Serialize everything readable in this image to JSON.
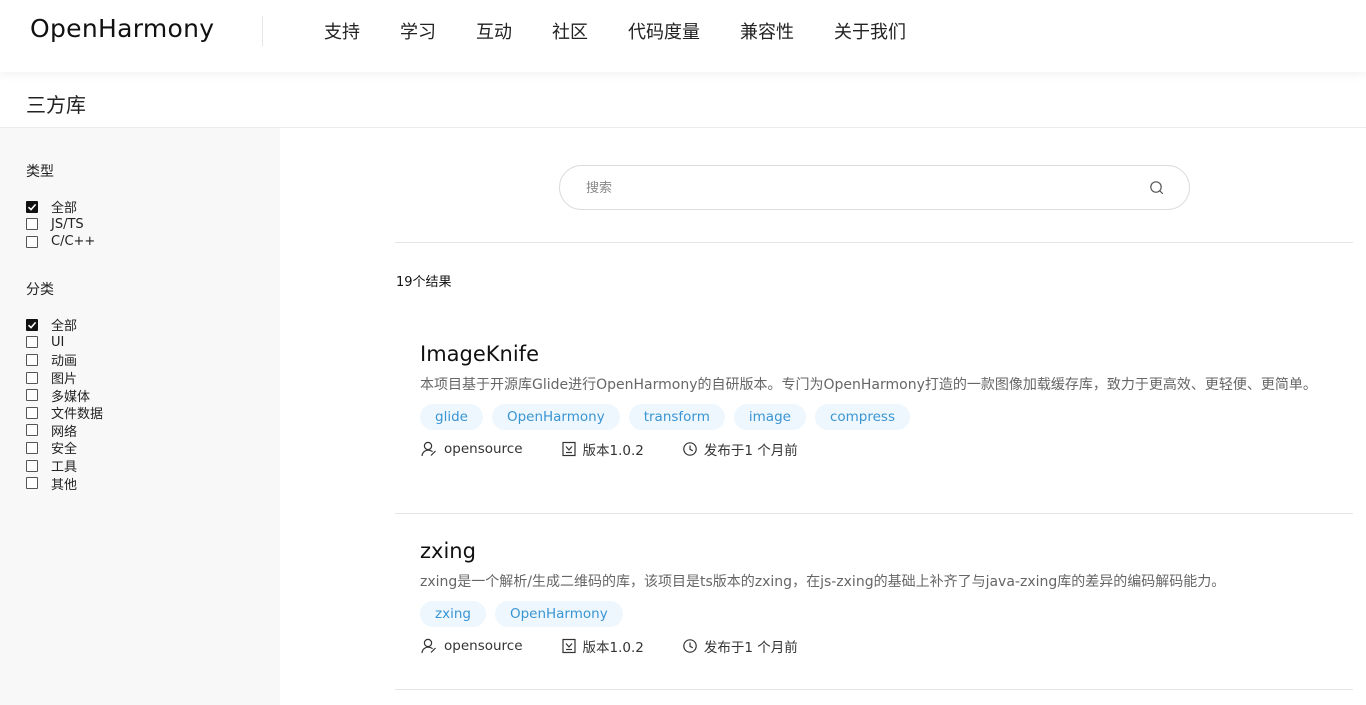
{
  "header": {
    "logo": "OpenHarmony",
    "nav": [
      "支持",
      "学习",
      "互动",
      "社区",
      "代码度量",
      "兼容性",
      "关于我们"
    ]
  },
  "page_title": "三方库",
  "sidebar": {
    "type_filter": {
      "title": "类型",
      "options": [
        {
          "label": "全部",
          "checked": true
        },
        {
          "label": "JS/TS",
          "checked": false
        },
        {
          "label": "C/C++",
          "checked": false
        }
      ]
    },
    "category_filter": {
      "title": "分类",
      "options": [
        {
          "label": "全部",
          "checked": true
        },
        {
          "label": "UI",
          "checked": false
        },
        {
          "label": "动画",
          "checked": false
        },
        {
          "label": "图片",
          "checked": false
        },
        {
          "label": "多媒体",
          "checked": false
        },
        {
          "label": "文件数据",
          "checked": false
        },
        {
          "label": "网络",
          "checked": false
        },
        {
          "label": "安全",
          "checked": false
        },
        {
          "label": "工具",
          "checked": false
        },
        {
          "label": "其他",
          "checked": false
        }
      ]
    }
  },
  "search": {
    "placeholder": "搜索",
    "value": ""
  },
  "result_count": "19个结果",
  "results": [
    {
      "name": "ImageKnife",
      "description": "本项目基于开源库Glide进行OpenHarmony的自研版本。专门为OpenHarmony打造的一款图像加载缓存库，致力于更高效、更轻便、更简单。",
      "tags": [
        "glide",
        "OpenHarmony",
        "transform",
        "image",
        "compress"
      ],
      "author": "opensource",
      "version": "版本1.0.2",
      "published": "发布于1 个月前"
    },
    {
      "name": "zxing",
      "description": "zxing是一个解析/生成二维码的库，该项目是ts版本的zxing，在js-zxing的基础上补齐了与java-zxing库的差异的编码解码能力。",
      "tags": [
        "zxing",
        "OpenHarmony"
      ],
      "author": "opensource",
      "version": "版本1.0.2",
      "published": "发布于1 个月前"
    }
  ],
  "colors": {
    "tag_bg": "#eef7fd",
    "tag_text": "#3a95d3",
    "sidebar_bg": "#f8f8f8"
  }
}
